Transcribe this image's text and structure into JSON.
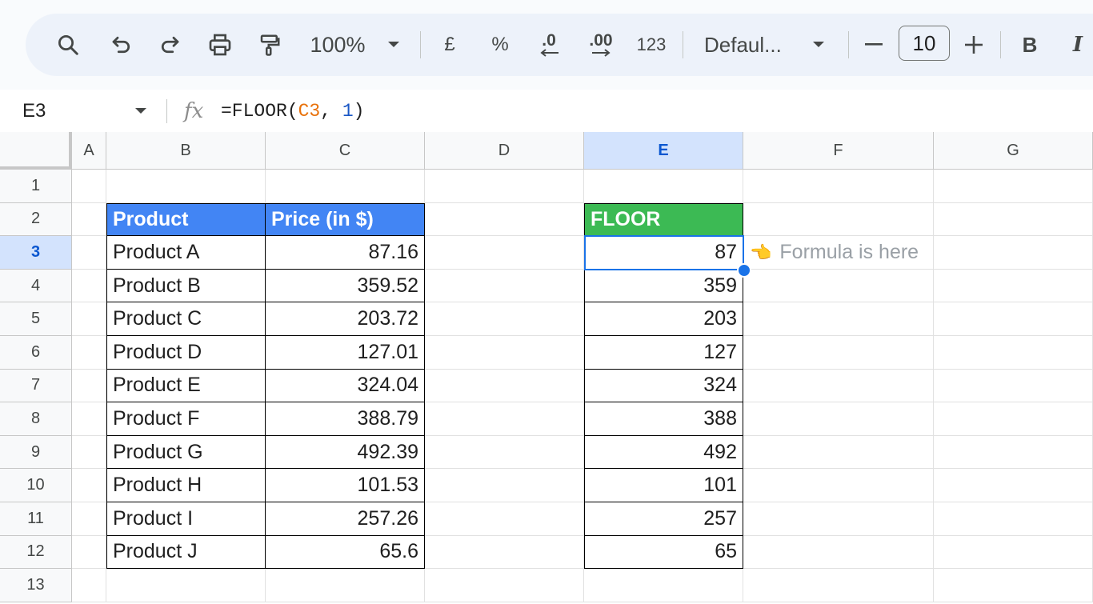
{
  "toolbar": {
    "zoom": "100%",
    "currency": "£",
    "percent": "%",
    "dec_decrease": ".0",
    "dec_increase": ".00",
    "number_format": "123",
    "font": "Defaul...",
    "font_size": "10",
    "bold": "B",
    "italic": "I"
  },
  "formula_bar": {
    "cell_ref": "E3",
    "fx": "fx",
    "formula_prefix": "=FLOOR(",
    "formula_ref": "C3",
    "formula_sep": ", ",
    "formula_arg": "1",
    "formula_suffix": ")"
  },
  "columns": [
    "A",
    "B",
    "C",
    "D",
    "E",
    "F",
    "G"
  ],
  "rows": [
    "1",
    "2",
    "3",
    "4",
    "5",
    "6",
    "7",
    "8",
    "9",
    "10",
    "11",
    "12",
    "13"
  ],
  "table1": {
    "headers": [
      "Product",
      "Price (in $)"
    ],
    "rows": [
      [
        "Product A",
        "87.16"
      ],
      [
        "Product B",
        "359.52"
      ],
      [
        "Product C",
        "203.72"
      ],
      [
        "Product D",
        "127.01"
      ],
      [
        "Product E",
        "324.04"
      ],
      [
        "Product F",
        "388.79"
      ],
      [
        "Product G",
        "492.39"
      ],
      [
        "Product H",
        "101.53"
      ],
      [
        "Product I",
        "257.26"
      ],
      [
        "Product J",
        "65.6"
      ]
    ]
  },
  "table2": {
    "header": "FLOOR",
    "values": [
      "87",
      "359",
      "203",
      "127",
      "324",
      "388",
      "492",
      "101",
      "257",
      "65"
    ]
  },
  "note": {
    "emoji": "👈",
    "text": "Formula is here"
  },
  "colors": {
    "header_blue": "#4285f4",
    "header_green": "#3cba54",
    "selection": "#1a73e8"
  }
}
